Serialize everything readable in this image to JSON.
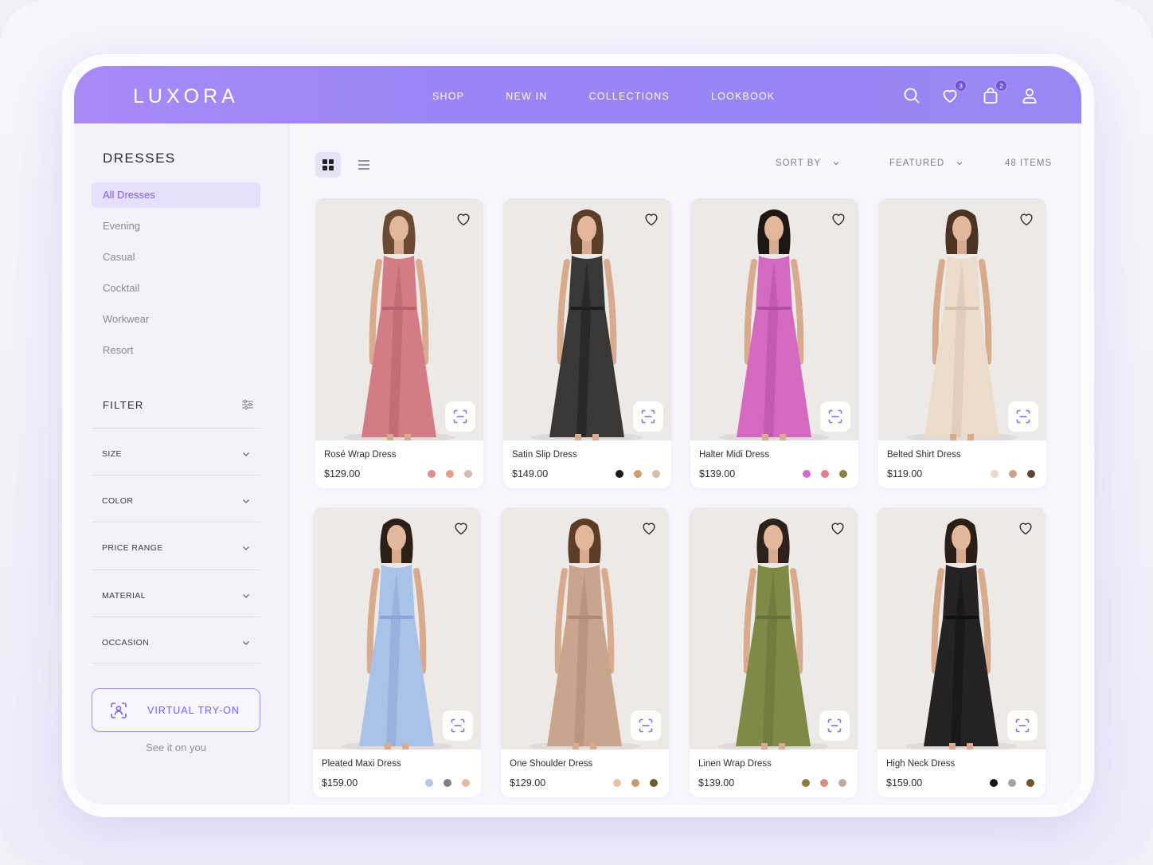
{
  "brand": "LUXORA",
  "nav": [
    "SHOP",
    "NEW IN",
    "COLLECTIONS",
    "LOOKBOOK"
  ],
  "header_icons": {
    "wishlist_count": "3",
    "cart_count": "2"
  },
  "sidebar": {
    "title": "DRESSES",
    "categories": [
      "All Dresses",
      "Evening",
      "Casual",
      "Cocktail",
      "Workwear",
      "Resort"
    ],
    "active_category": "All Dresses",
    "filter_title": "FILTER",
    "filters": [
      "SIZE",
      "COLOR",
      "PRICE RANGE",
      "MATERIAL",
      "OCCASION"
    ],
    "tryon_label": "VIRTUAL TRY-ON",
    "tryon_sub": "See it on you"
  },
  "toolbar": {
    "view_mode": "grid",
    "sort_label": "SORT BY",
    "sort_value": "FEATURED",
    "items_count": "48 ITEMS"
  },
  "colors": {
    "accent": "#9b86f5",
    "accent_dark": "#7a5df0"
  },
  "products": [
    {
      "name": "Rosé Wrap Dress",
      "price": "$129.00",
      "dress": "#d47c86",
      "dress_dark": "#b8606c",
      "hair": "#6b4a33",
      "swatches": [
        "#e08b93",
        "#e6a187",
        "#d9b7aa"
      ]
    },
    {
      "name": "Satin Slip Dress",
      "price": "$149.00",
      "dress": "#3a3836",
      "dress_dark": "#1f1e1d",
      "hair": "#5a3e2a",
      "swatches": [
        "#1b1b1b",
        "#d29a70",
        "#d6bfaf"
      ]
    },
    {
      "name": "Halter Midi Dress",
      "price": "$139.00",
      "dress": "#d36ac0",
      "dress_dark": "#b24ea2",
      "hair": "#1e1714",
      "swatches": [
        "#d36cc5",
        "#e0808c",
        "#8b8042"
      ]
    },
    {
      "name": "Belted Shirt Dress",
      "price": "$119.00",
      "dress": "#ecdccb",
      "dress_dark": "#d7c3ad",
      "hair": "#4c3423",
      "swatches": [
        "#ead8cf",
        "#c9a090",
        "#5b4632"
      ]
    },
    {
      "name": "Pleated Maxi Dress",
      "price": "$159.00",
      "dress": "#a9c2e8",
      "dress_dark": "#8aa6d6",
      "hair": "#2b1f18",
      "swatches": [
        "#b8c6ea",
        "#808088",
        "#e6b8a6"
      ]
    },
    {
      "name": "One Shoulder Dress",
      "price": "$129.00",
      "dress": "#c8a58c",
      "dress_dark": "#ad8a72",
      "hair": "#5c3d28",
      "swatches": [
        "#e4c1ad",
        "#c99a74",
        "#6e5d2f"
      ]
    },
    {
      "name": "Linen Wrap Dress",
      "price": "$139.00",
      "dress": "#7e8a46",
      "dress_dark": "#66713a",
      "hair": "#2c221b",
      "swatches": [
        "#8c7a3e",
        "#d98e80",
        "#c6a7a0"
      ]
    },
    {
      "name": "High Neck Dress",
      "price": "$159.00",
      "dress": "#242222",
      "dress_dark": "#121111",
      "hair": "#2a1e17",
      "swatches": [
        "#151515",
        "#a5a2ab",
        "#6b5430"
      ]
    }
  ]
}
